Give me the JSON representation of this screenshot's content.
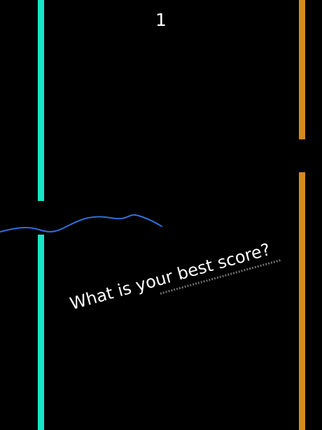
{
  "game": {
    "score": "1",
    "prompt": "What is your best score?"
  },
  "colors": {
    "background": "#000000",
    "left_wall": "#19e6c8",
    "right_wall": "#d58a1f",
    "trail": "#2f6fe0",
    "text": "#ffffff"
  }
}
